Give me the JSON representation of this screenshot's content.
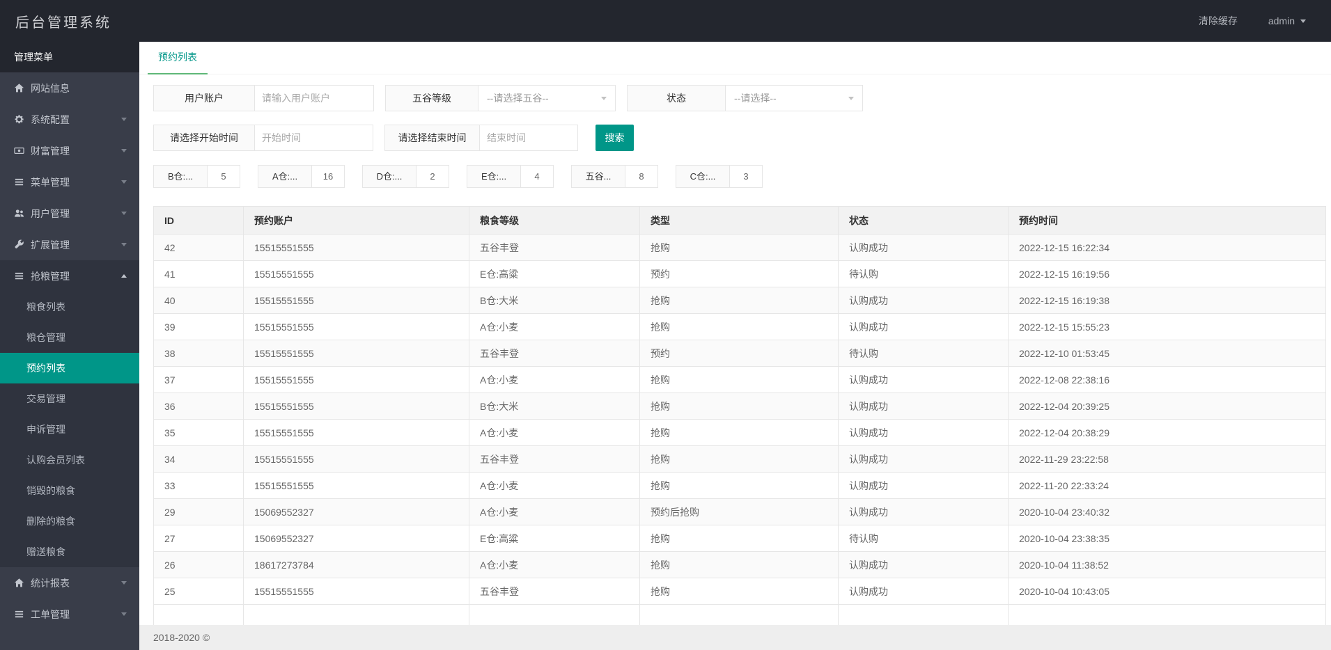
{
  "app": {
    "title": "后台管理系统"
  },
  "header": {
    "clear_cache": "清除缓存",
    "user": "admin"
  },
  "sidebar": {
    "section_title": "管理菜单",
    "items": [
      {
        "name": "website-info",
        "label": "网站信息",
        "icon": "home",
        "expandable": false
      },
      {
        "name": "system-config",
        "label": "系统配置",
        "icon": "gear",
        "expandable": true
      },
      {
        "name": "wealth-mgmt",
        "label": "财富管理",
        "icon": "money",
        "expandable": true
      },
      {
        "name": "menu-mgmt",
        "label": "菜单管理",
        "icon": "list",
        "expandable": true
      },
      {
        "name": "user-mgmt",
        "label": "用户管理",
        "icon": "users",
        "expandable": true
      },
      {
        "name": "extension-mgmt",
        "label": "扩展管理",
        "icon": "wrench",
        "expandable": true
      },
      {
        "name": "grain-rush-mgmt",
        "label": "抢粮管理",
        "icon": "list",
        "expandable": true,
        "expanded": true,
        "children": [
          {
            "name": "grain-list",
            "label": "粮食列表",
            "active": false
          },
          {
            "name": "granary-mgmt",
            "label": "粮仓管理",
            "active": false
          },
          {
            "name": "reservation-list",
            "label": "预约列表",
            "active": true
          },
          {
            "name": "trade-mgmt",
            "label": "交易管理",
            "active": false
          },
          {
            "name": "appeal-mgmt",
            "label": "申诉管理",
            "active": false
          },
          {
            "name": "subscribe-member-list",
            "label": "认购会员列表",
            "active": false
          },
          {
            "name": "destroyed-grain",
            "label": "销毁的粮食",
            "active": false
          },
          {
            "name": "deleted-grain",
            "label": "删除的粮食",
            "active": false
          },
          {
            "name": "gifted-grain",
            "label": "赠送粮食",
            "active": false
          }
        ]
      },
      {
        "name": "stats-report",
        "label": "统计报表",
        "icon": "home",
        "expandable": true
      },
      {
        "name": "workorder-mgmt",
        "label": "工单管理",
        "icon": "list",
        "expandable": true
      }
    ]
  },
  "tabs": {
    "active": "预约列表"
  },
  "filters": {
    "row1": [
      {
        "name": "user-account",
        "label": "用户账户",
        "type": "input",
        "placeholder": "请输入用户账户"
      },
      {
        "name": "grain-grade",
        "label": "五谷等级",
        "type": "select",
        "placeholder": "--请选择五谷--"
      },
      {
        "name": "status",
        "label": "状态",
        "type": "select",
        "placeholder": "--请选择--"
      }
    ],
    "row2": [
      {
        "name": "start-time",
        "label": "请选择开始时间",
        "type": "input",
        "placeholder": "开始时间"
      },
      {
        "name": "end-time",
        "label": "请选择结束时间",
        "type": "input",
        "placeholder": "结束时间"
      }
    ],
    "search": "搜索"
  },
  "stats": [
    {
      "label": "B仓:...",
      "value": "5"
    },
    {
      "label": "A仓:...",
      "value": "16"
    },
    {
      "label": "D仓:...",
      "value": "2"
    },
    {
      "label": "E仓:...",
      "value": "4"
    },
    {
      "label": "五谷...",
      "value": "8"
    },
    {
      "label": "C仓:...",
      "value": "3"
    }
  ],
  "table": {
    "columns": [
      "ID",
      "预约账户",
      "粮食等级",
      "类型",
      "状态",
      "预约时间"
    ],
    "rows": [
      [
        "42",
        "15515551555",
        "五谷丰登",
        "抢购",
        "认购成功",
        "2022-12-15 16:22:34"
      ],
      [
        "41",
        "15515551555",
        "E仓:高粱",
        "预约",
        "待认购",
        "2022-12-15 16:19:56"
      ],
      [
        "40",
        "15515551555",
        "B仓:大米",
        "抢购",
        "认购成功",
        "2022-12-15 16:19:38"
      ],
      [
        "39",
        "15515551555",
        "A仓:小麦",
        "抢购",
        "认购成功",
        "2022-12-15 15:55:23"
      ],
      [
        "38",
        "15515551555",
        "五谷丰登",
        "预约",
        "待认购",
        "2022-12-10 01:53:45"
      ],
      [
        "37",
        "15515551555",
        "A仓:小麦",
        "抢购",
        "认购成功",
        "2022-12-08 22:38:16"
      ],
      [
        "36",
        "15515551555",
        "B仓:大米",
        "抢购",
        "认购成功",
        "2022-12-04 20:39:25"
      ],
      [
        "35",
        "15515551555",
        "A仓:小麦",
        "抢购",
        "认购成功",
        "2022-12-04 20:38:29"
      ],
      [
        "34",
        "15515551555",
        "五谷丰登",
        "抢购",
        "认购成功",
        "2022-11-29 23:22:58"
      ],
      [
        "33",
        "15515551555",
        "A仓:小麦",
        "抢购",
        "认购成功",
        "2022-11-20 22:33:24"
      ],
      [
        "29",
        "15069552327",
        "A仓:小麦",
        "预约后抢购",
        "认购成功",
        "2020-10-04 23:40:32"
      ],
      [
        "27",
        "15069552327",
        "E仓:高粱",
        "抢购",
        "待认购",
        "2020-10-04 23:38:35"
      ],
      [
        "26",
        "18617273784",
        "A仓:小麦",
        "抢购",
        "认购成功",
        "2020-10-04 11:38:52"
      ],
      [
        "25",
        "15515551555",
        "五谷丰登",
        "抢购",
        "认购成功",
        "2020-10-04 10:43:05"
      ]
    ]
  },
  "footer": {
    "copyright": "2018-2020 ©"
  },
  "colors": {
    "accent": "#009688",
    "tab_underline": "#5FB878",
    "header_bg": "#23262E",
    "sidebar_bg": "#393D49",
    "submenu_bg": "#2F333E",
    "border": "#E6E6E6"
  }
}
